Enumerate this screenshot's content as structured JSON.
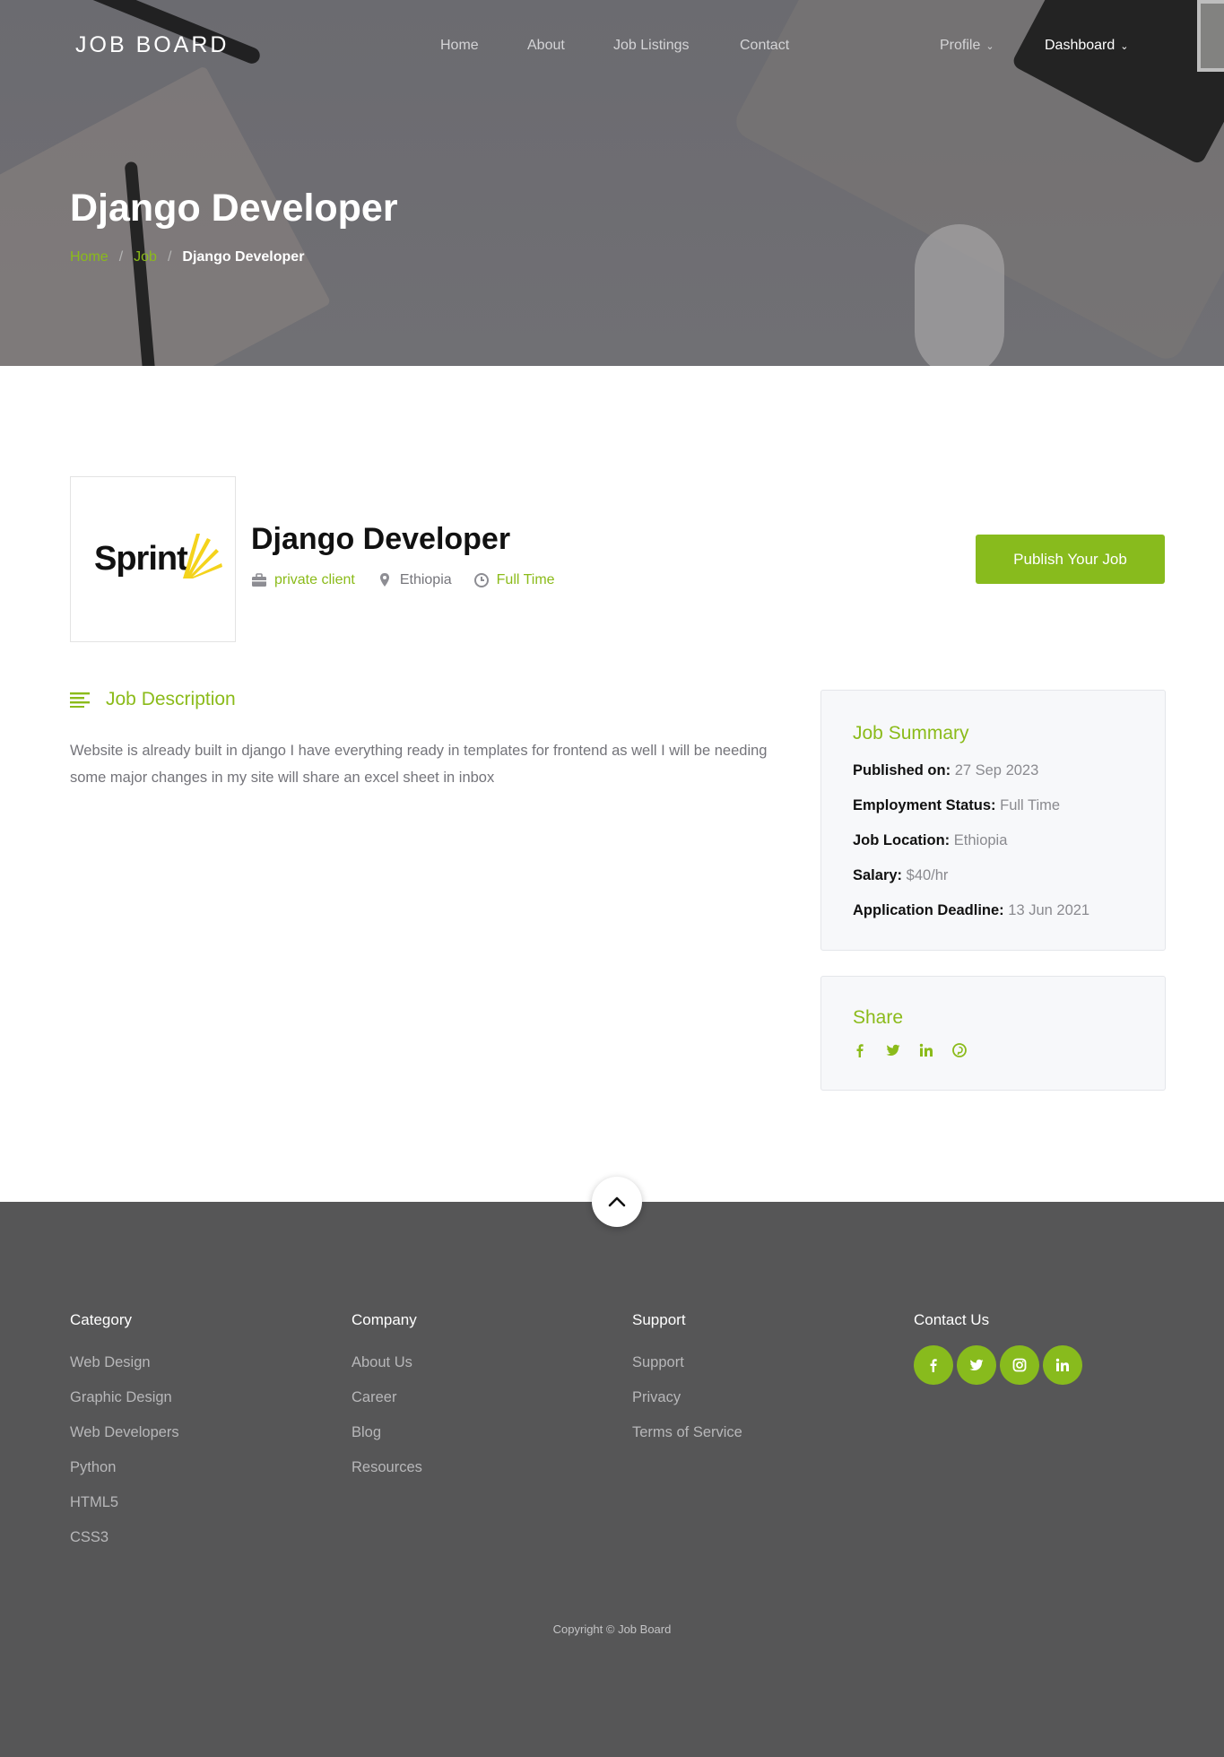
{
  "nav": {
    "brand": "JOB BOARD",
    "links": [
      "Home",
      "About",
      "Job Listings",
      "Contact"
    ],
    "profile": "Profile",
    "dashboard": "Dashboard"
  },
  "hero": {
    "title": "Django Developer",
    "breadcrumb": [
      "Home",
      "Job",
      "Django Developer"
    ]
  },
  "job": {
    "company_logo_text": "Sprint",
    "title": "Django Developer",
    "company": "private client",
    "location": "Ethiopia",
    "type": "Full Time",
    "publish_button": "Publish Your Job",
    "description_heading": "Job Description",
    "description": "Website is already built in django I have everything ready in templates for frontend as well I will be needing some major changes in my site will share an excel sheet in inbox"
  },
  "summary": {
    "heading": "Job Summary",
    "rows": [
      {
        "label": "Published on:",
        "value": "27 Sep 2023"
      },
      {
        "label": "Employment Status:",
        "value": "Full Time"
      },
      {
        "label": "Job Location:",
        "value": "Ethiopia"
      },
      {
        "label": "Salary:",
        "value": "$40/hr"
      },
      {
        "label": "Application Deadline:",
        "value": "13 Jun 2021"
      }
    ]
  },
  "share": {
    "heading": "Share",
    "icons": [
      "facebook-icon",
      "twitter-icon",
      "linkedin-icon",
      "pinterest-icon"
    ]
  },
  "footer": {
    "columns": [
      {
        "heading": "Category",
        "links": [
          "Web Design",
          "Graphic Design",
          "Web Developers",
          "Python",
          "HTML5",
          "CSS3"
        ]
      },
      {
        "heading": "Company",
        "links": [
          "About Us",
          "Career",
          "Blog",
          "Resources"
        ]
      },
      {
        "heading": "Support",
        "links": [
          "Support",
          "Privacy",
          "Terms of Service"
        ]
      }
    ],
    "contact_heading": "Contact Us",
    "social_icons": [
      "facebook-icon",
      "twitter-icon",
      "instagram-icon",
      "linkedin-icon"
    ],
    "copyright": "Copyright © Job Board"
  },
  "colors": {
    "accent": "#88bb1d",
    "footer_bg": "#565657",
    "card_bg": "#f7f8fa"
  }
}
